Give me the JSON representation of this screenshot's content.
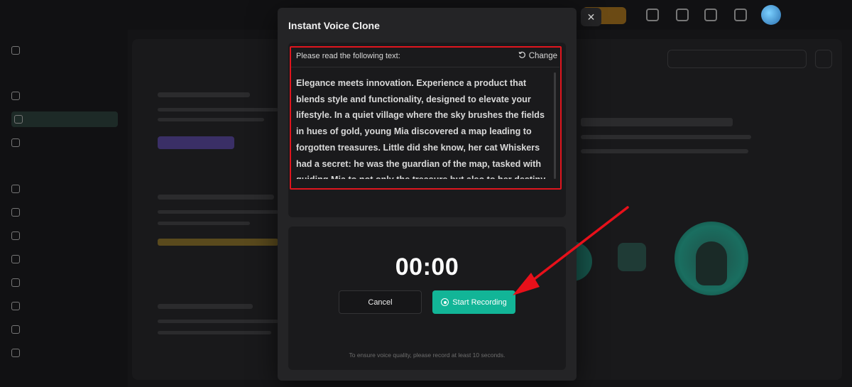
{
  "modal": {
    "title": "Instant Voice Clone",
    "close_symbol": "✕",
    "read_label": "Please read the following text:",
    "change_label": "Change",
    "read_text": "Elegance meets innovation. Experience a product that blends style and functionality, designed to elevate your lifestyle. In a quiet village where the sky brushes the fields in hues of gold, young Mia discovered a map leading to forgotten treasures. Little did she know, her cat Whiskers had a secret: he was the guardian of the map, tasked with guiding Mia to not only the treasure but also to her destiny.",
    "timer": "00:00",
    "cancel_label": "Cancel",
    "start_label": "Start Recording",
    "hint": "To ensure voice quality, please record at least 10 seconds."
  },
  "colors": {
    "accent": "#12b597",
    "highlight_border": "#e0151e",
    "annotation_arrow": "#e8101a"
  },
  "icons": {
    "change": "refresh-icon",
    "start": "record-icon",
    "close": "close-icon"
  }
}
